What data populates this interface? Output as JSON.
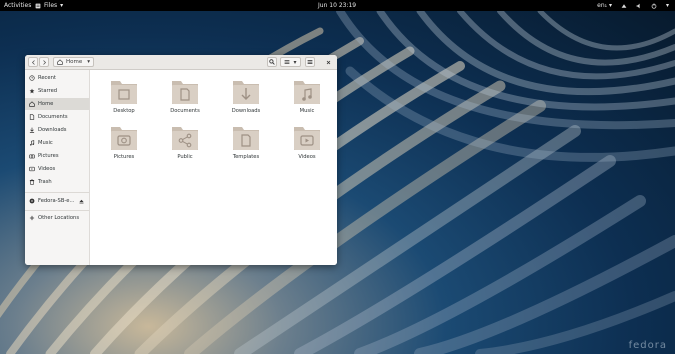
{
  "topbar": {
    "activities": "Activities",
    "app_menu": "Files",
    "clock": "Jun 10  23:19",
    "input_source": "en₁"
  },
  "wallpaper": {
    "watermark": "fedora"
  },
  "window": {
    "path": "Home",
    "sidebar": {
      "items": [
        {
          "label": "Recent",
          "icon": "clock-icon"
        },
        {
          "label": "Starred",
          "icon": "star-icon"
        },
        {
          "label": "Home",
          "icon": "home-icon"
        },
        {
          "label": "Documents",
          "icon": "document-icon"
        },
        {
          "label": "Downloads",
          "icon": "download-icon"
        },
        {
          "label": "Music",
          "icon": "music-icon"
        },
        {
          "label": "Pictures",
          "icon": "camera-icon"
        },
        {
          "label": "Videos",
          "icon": "video-icon"
        },
        {
          "label": "Trash",
          "icon": "trash-icon"
        }
      ],
      "device": "Fedora-SB-e...",
      "other": "Other Locations"
    },
    "folders": [
      {
        "label": "Desktop",
        "icon": "desktop-icon"
      },
      {
        "label": "Documents",
        "icon": "document-icon"
      },
      {
        "label": "Downloads",
        "icon": "download-icon"
      },
      {
        "label": "Music",
        "icon": "music-icon"
      },
      {
        "label": "Pictures",
        "icon": "camera-icon"
      },
      {
        "label": "Public",
        "icon": "share-icon"
      },
      {
        "label": "Templates",
        "icon": "template-icon"
      },
      {
        "label": "Videos",
        "icon": "video-icon"
      }
    ]
  },
  "colors": {
    "folder": "#d9cfc4",
    "folder_dark": "#c9bdb0",
    "accent": "#3584e4"
  }
}
